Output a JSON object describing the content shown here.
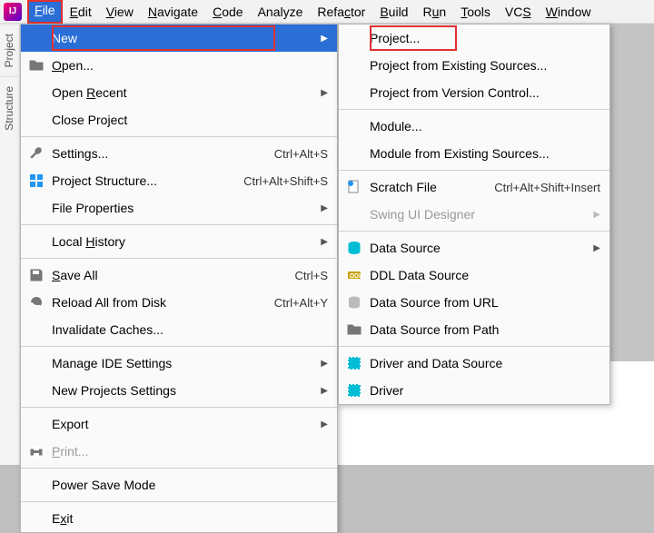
{
  "menubar": [
    "File",
    "Edit",
    "View",
    "Navigate",
    "Code",
    "Analyze",
    "Refactor",
    "Build",
    "Run",
    "Tools",
    "VCS",
    "Window"
  ],
  "menubar_mn": [
    0,
    0,
    0,
    0,
    0,
    -1,
    4,
    0,
    1,
    0,
    2,
    0
  ],
  "sidebar": {
    "tabs": [
      "Project",
      "Structure"
    ]
  },
  "file_menu": [
    {
      "label": "New",
      "mn": -1,
      "arrow": true,
      "selected": true,
      "boxed": true
    },
    {
      "label": "Open...",
      "mn": 0,
      "icon": "folder-icon"
    },
    {
      "label": "Open Recent",
      "mn": 5,
      "arrow": true
    },
    {
      "label": "Close Project",
      "mn": -1
    },
    {
      "sep": true
    },
    {
      "label": "Settings...",
      "mn": -1,
      "icon": "wrench-icon",
      "shortcut": "Ctrl+Alt+S"
    },
    {
      "label": "Project Structure...",
      "mn": -1,
      "icon": "structure-icon",
      "shortcut": "Ctrl+Alt+Shift+S"
    },
    {
      "label": "File Properties",
      "mn": -1,
      "arrow": true
    },
    {
      "sep": true
    },
    {
      "label": "Local History",
      "mn": 6,
      "arrow": true
    },
    {
      "sep": true
    },
    {
      "label": "Save All",
      "mn": 0,
      "icon": "disk-icon",
      "shortcut": "Ctrl+S"
    },
    {
      "label": "Reload All from Disk",
      "mn": -1,
      "icon": "reload-icon",
      "shortcut": "Ctrl+Alt+Y"
    },
    {
      "label": "Invalidate Caches...",
      "mn": -1
    },
    {
      "sep": true
    },
    {
      "label": "Manage IDE Settings",
      "mn": -1,
      "arrow": true
    },
    {
      "label": "New Projects Settings",
      "mn": -1,
      "arrow": true
    },
    {
      "sep": true
    },
    {
      "label": "Export",
      "mn": -1,
      "arrow": true
    },
    {
      "label": "Print...",
      "mn": 0,
      "icon": "printer-icon",
      "disabled": true
    },
    {
      "sep": true
    },
    {
      "label": "Power Save Mode",
      "mn": -1
    },
    {
      "sep": true
    },
    {
      "label": "Exit",
      "mn": 1
    }
  ],
  "new_submenu": [
    {
      "label": "Project...",
      "boxed": true
    },
    {
      "label": "Project from Existing Sources..."
    },
    {
      "label": "Project from Version Control..."
    },
    {
      "sep": true
    },
    {
      "label": "Module..."
    },
    {
      "label": "Module from Existing Sources..."
    },
    {
      "sep": true
    },
    {
      "label": "Scratch File",
      "icon": "scratch-icon",
      "shortcut": "Ctrl+Alt+Shift+Insert"
    },
    {
      "label": "Swing UI Designer",
      "disabled": true,
      "arrow": true
    },
    {
      "sep": true
    },
    {
      "label": "Data Source",
      "icon": "db-icon",
      "arrow": true
    },
    {
      "label": "DDL Data Source",
      "icon": "ddl-icon"
    },
    {
      "label": "Data Source from URL",
      "icon": "url-db-icon"
    },
    {
      "label": "Data Source from Path",
      "icon": "folder-icon"
    },
    {
      "sep": true
    },
    {
      "label": "Driver and Data Source",
      "icon": "driver-icon"
    },
    {
      "label": "Driver",
      "icon": "driver-icon"
    }
  ]
}
